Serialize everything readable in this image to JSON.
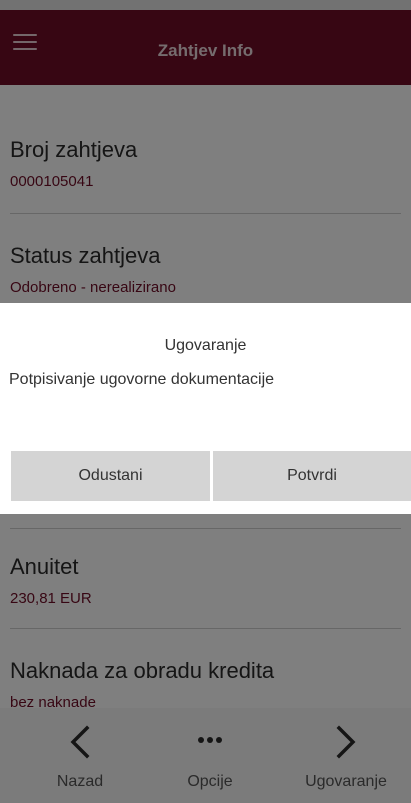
{
  "header": {
    "title": "Zahtjev Info",
    "menu_icon": "hamburger-menu-icon",
    "background": "#6f0d27"
  },
  "fields": [
    {
      "label": "Broj zahtjeva",
      "value": "0000105041"
    },
    {
      "label": "Status zahtjeva",
      "value": "Odobreno - nerealizirano"
    },
    {
      "label": "Anuitet",
      "value": "230,81 EUR"
    },
    {
      "label": "Naknada za obradu kredita",
      "value": "bez naknade"
    }
  ],
  "dialog": {
    "title": "Ugovaranje",
    "message": "Potpisivanje ugovorne dokumentacije",
    "cancel_label": "Odustani",
    "confirm_label": "Potvrdi"
  },
  "nav": {
    "back_label": "Nazad",
    "back_icon": "chevron-left-icon",
    "options_label": "Opcije",
    "options_icon": "more-horizontal-icon",
    "forward_label": "Ugovaranje",
    "forward_icon": "chevron-right-icon"
  },
  "colors": {
    "accent": "#6f0d27",
    "value_text": "#6f0d27",
    "dialog_button": "#d4d4d4"
  }
}
